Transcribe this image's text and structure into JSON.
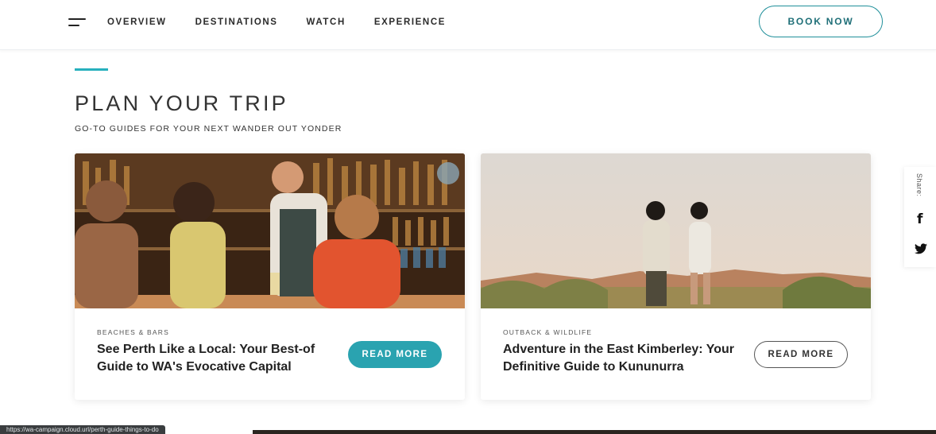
{
  "header": {
    "nav": [
      "OVERVIEW",
      "DESTINATIONS",
      "WATCH",
      "EXPERIENCE"
    ],
    "book_label": "BOOK NOW"
  },
  "section": {
    "title": "PLAN YOUR TRIP",
    "subtitle": "GO-TO GUIDES FOR YOUR NEXT WANDER OUT YONDER"
  },
  "cards": [
    {
      "category": "BEACHES & BARS",
      "title": "See Perth Like a Local: Your Best-of Guide to WA's Evocative Capital",
      "button": "READ MORE"
    },
    {
      "category": "OUTBACK & WILDLIFE",
      "title": "Adventure in the East Kimberley: Your Definitive Guide to Kununurra",
      "button": "READ MORE"
    }
  ],
  "share": {
    "label": "Share:",
    "icons": [
      "facebook-icon",
      "twitter-icon"
    ]
  },
  "status": {
    "url": "https://wa-campaign.cloud.url/perth-guide-things-to-do"
  },
  "colors": {
    "accent": "#27b0bd",
    "button_teal": "#2aa3b0"
  }
}
